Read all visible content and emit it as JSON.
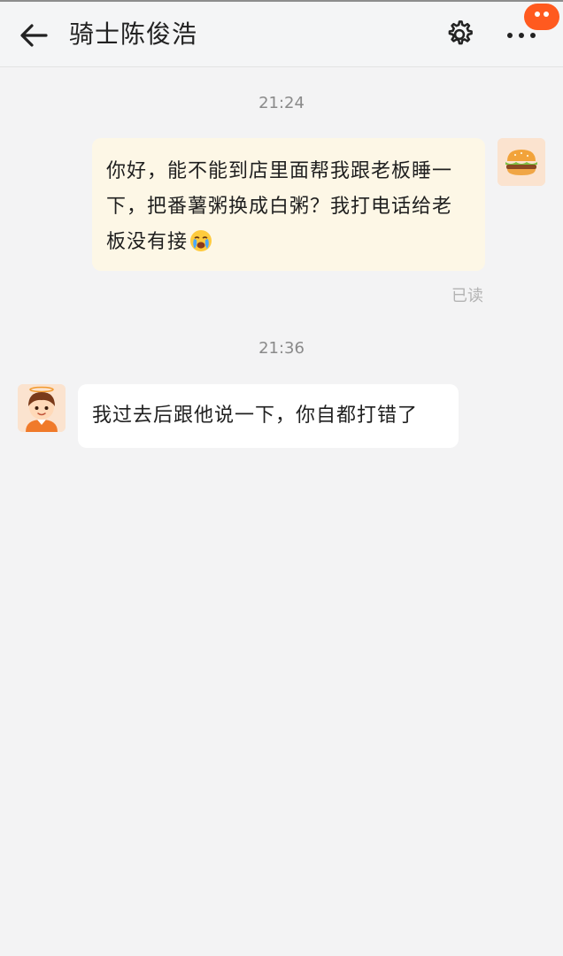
{
  "header": {
    "title": "骑士陈俊浩",
    "back_icon": "arrow-left-icon",
    "settings_icon": "gear-icon",
    "more_icon": "more-dots-icon"
  },
  "messages": [
    {
      "time": "21:24"
    },
    {
      "direction": "outgoing",
      "text": "你好，能不能到店里面帮我跟老板睡一下，把番薯粥换成白粥？我打电话给老板没有接",
      "emoji": "crying-face-emoji",
      "status": "已读",
      "avatar": "burger-avatar"
    },
    {
      "time": "21:36"
    },
    {
      "direction": "incoming",
      "text": "我过去后跟他说一下，你自都打错了",
      "avatar": "rider-avatar"
    }
  ],
  "colors": {
    "background": "#f3f3f4",
    "outgoing_bubble": "#fdf7e6",
    "incoming_bubble": "#ffffff",
    "badge": "#ff5a1f"
  }
}
